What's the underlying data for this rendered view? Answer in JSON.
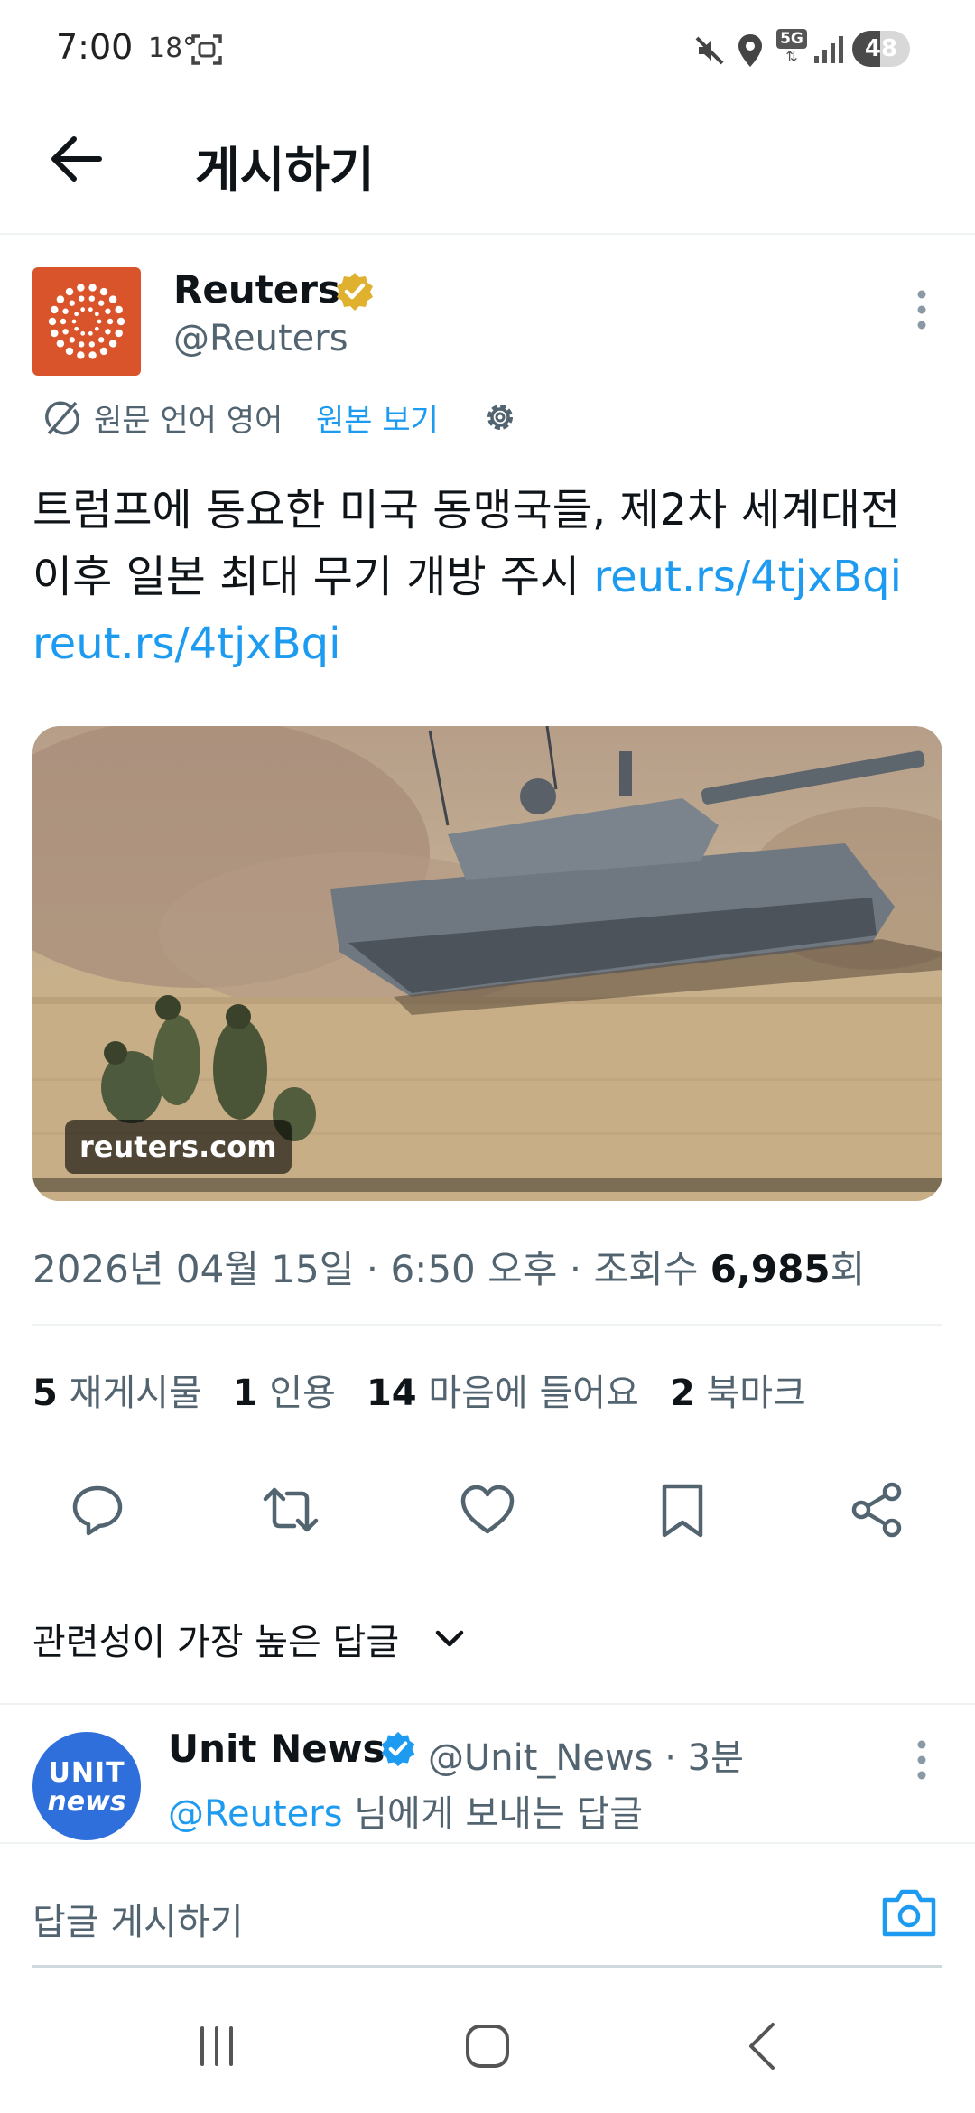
{
  "status_bar": {
    "time": "7:00",
    "temperature": "18°",
    "network": "5G",
    "battery_level": "48",
    "battery_fraction": 0.48
  },
  "header": {
    "back_icon": "arrow-left-icon",
    "title": "게시하기"
  },
  "tweet": {
    "author_name": "Reuters",
    "author_handle": "@Reuters",
    "verified": "gold-verified-icon",
    "translate": {
      "original_language": "원문 언어 영어",
      "view_original": "원본 보기"
    },
    "text": "트럼프에 동요한 미국 동맹국들, 제2차 세계대전 이후 일본 최대 무기 개방 주시 ",
    "link_1": "reut.rs/4tjxBqi",
    "link_2": "reut.rs/4tjxBqi",
    "media_domain": "reuters.com",
    "meta": {
      "date_time": "2026년 04월 15일 · 6:50 오후 · 조회수 ",
      "views": "6,985",
      "views_suffix": "회"
    },
    "stats": {
      "reposts": "5",
      "reposts_label": "재게시물",
      "quotes": "1",
      "quotes_label": "인용",
      "likes": "14",
      "likes_label": "마음에 들어요",
      "bookmarks": "2",
      "bookmarks_label": "북마크"
    }
  },
  "replies": {
    "sort_label": "관련성이 가장 높은 답글",
    "first": {
      "avatar_top": "UNIT",
      "avatar_bottom": "news",
      "name": "Unit News",
      "handle_time": "@Unit_News · 3분",
      "mention": "@Reuters",
      "reply_to_suffix": " 님에게 보내는 답글"
    }
  },
  "compose": {
    "placeholder": "답글 게시하기"
  },
  "colors": {
    "accent": "#1d9bf0",
    "reuters_orange": "#d9542a",
    "verified_gold": "#e0b02f",
    "unit_blue": "#2e6fdb"
  }
}
